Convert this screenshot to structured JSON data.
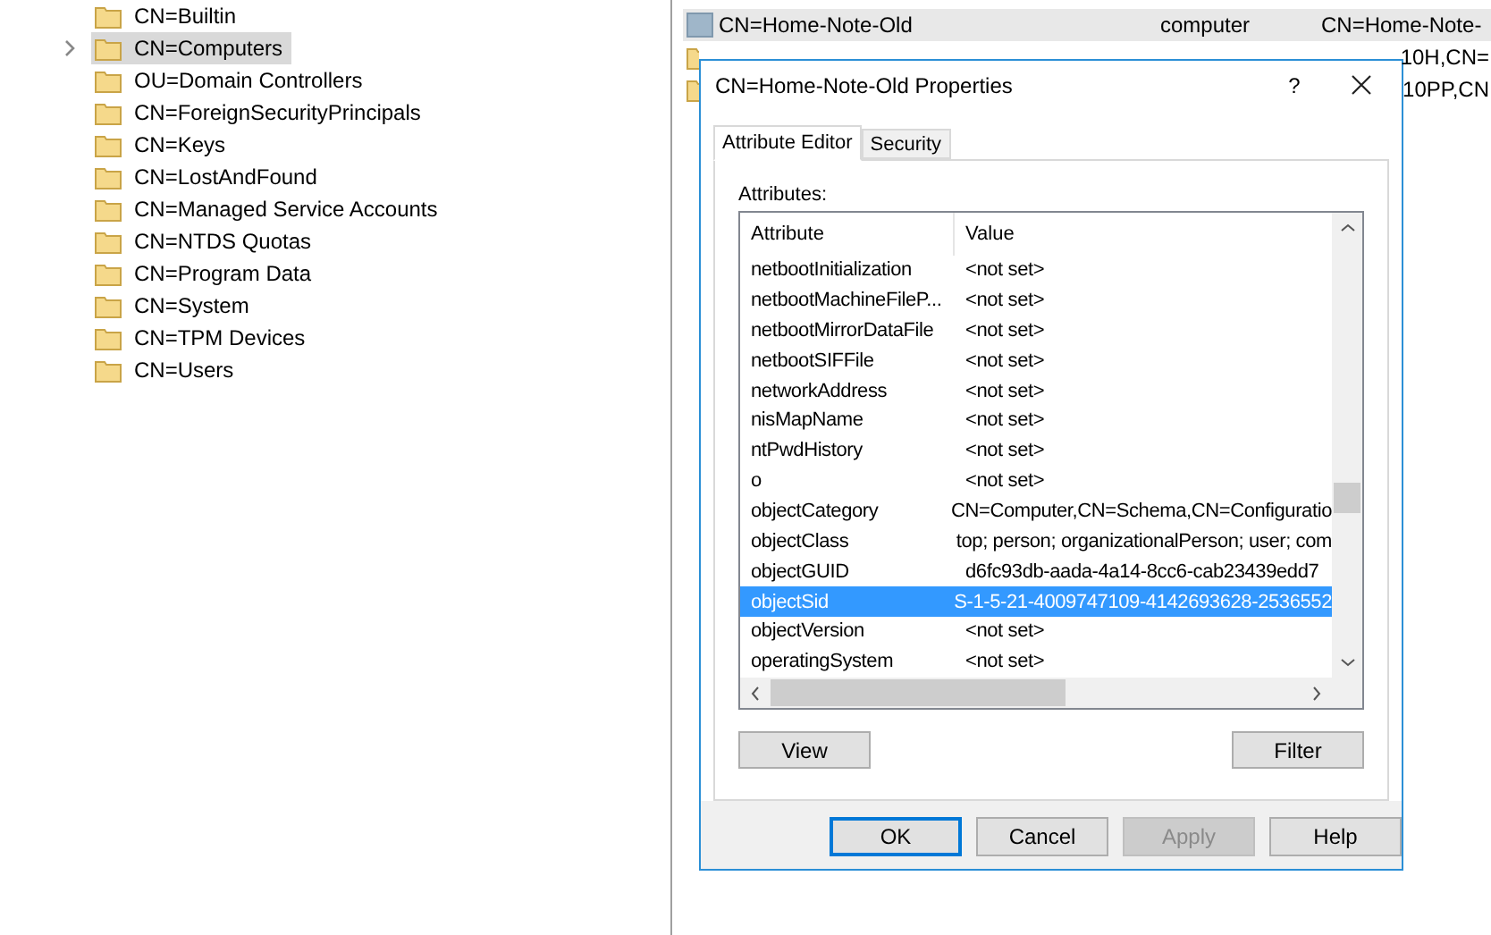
{
  "tree": {
    "items": [
      {
        "label": "CN=Builtin",
        "selected": false,
        "expandable": false
      },
      {
        "label": "CN=Computers",
        "selected": true,
        "expandable": true
      },
      {
        "label": "OU=Domain Controllers",
        "selected": false,
        "expandable": false
      },
      {
        "label": "CN=ForeignSecurityPrincipals",
        "selected": false,
        "expandable": false
      },
      {
        "label": "CN=Keys",
        "selected": false,
        "expandable": false
      },
      {
        "label": "CN=LostAndFound",
        "selected": false,
        "expandable": false
      },
      {
        "label": "CN=Managed Service Accounts",
        "selected": false,
        "expandable": false
      },
      {
        "label": "CN=NTDS Quotas",
        "selected": false,
        "expandable": false
      },
      {
        "label": "CN=Program Data",
        "selected": false,
        "expandable": false
      },
      {
        "label": "CN=System",
        "selected": false,
        "expandable": false
      },
      {
        "label": "CN=TPM Devices",
        "selected": false,
        "expandable": false
      },
      {
        "label": "CN=Users",
        "selected": false,
        "expandable": false
      }
    ]
  },
  "list": {
    "rows": [
      {
        "kind": "computer",
        "name": "CN=Home-Note-Old",
        "type": "computer",
        "dn": "CN=Home-Note-",
        "selected": true
      },
      {
        "kind": "folder",
        "dn": "10H,CN=",
        "selected": false
      },
      {
        "kind": "folder",
        "dn": "10PP,CN",
        "selected": false
      }
    ]
  },
  "dialog": {
    "title": "CN=Home-Note-Old Properties",
    "help": "?",
    "tabs": [
      {
        "label": "Attribute Editor",
        "selected": true
      },
      {
        "label": "Security",
        "selected": false
      }
    ],
    "attributes_label": "Attributes:",
    "columns": [
      "Attribute",
      "Value"
    ],
    "rows": [
      {
        "attribute": "netbootInitialization",
        "value": "<not set>",
        "selected": false
      },
      {
        "attribute": "netbootMachineFileP...",
        "value": "<not set>",
        "selected": false
      },
      {
        "attribute": "netbootMirrorDataFile",
        "value": "<not set>",
        "selected": false
      },
      {
        "attribute": "netbootSIFFile",
        "value": "<not set>",
        "selected": false
      },
      {
        "attribute": "networkAddress",
        "value": "<not set>",
        "selected": false
      },
      {
        "attribute": "nisMapName",
        "value": "<not set>",
        "selected": false
      },
      {
        "attribute": "ntPwdHistory",
        "value": "<not set>",
        "selected": false
      },
      {
        "attribute": "o",
        "value": "<not set>",
        "selected": false
      },
      {
        "attribute": "objectCategory",
        "value": "CN=Computer,CN=Schema,CN=Configuratio",
        "selected": false
      },
      {
        "attribute": "objectClass",
        "value": "top; person; organizationalPerson; user; com",
        "selected": false
      },
      {
        "attribute": "objectGUID",
        "value": "d6fc93db-aada-4a14-8cc6-cab23439edd7",
        "selected": false
      },
      {
        "attribute": "objectSid",
        "value": "S-1-5-21-4009747109-4142693628-2536552",
        "selected": true
      },
      {
        "attribute": "objectVersion",
        "value": "<not set>",
        "selected": false
      },
      {
        "attribute": "operatingSystem",
        "value": "<not set>",
        "selected": false
      }
    ],
    "list_buttons": [
      "View",
      "Filter"
    ],
    "buttons": [
      {
        "label": "OK",
        "default": true,
        "disabled": false
      },
      {
        "label": "Cancel",
        "default": false,
        "disabled": false
      },
      {
        "label": "Apply",
        "default": false,
        "disabled": true
      },
      {
        "label": "Help",
        "default": false,
        "disabled": false
      }
    ]
  }
}
